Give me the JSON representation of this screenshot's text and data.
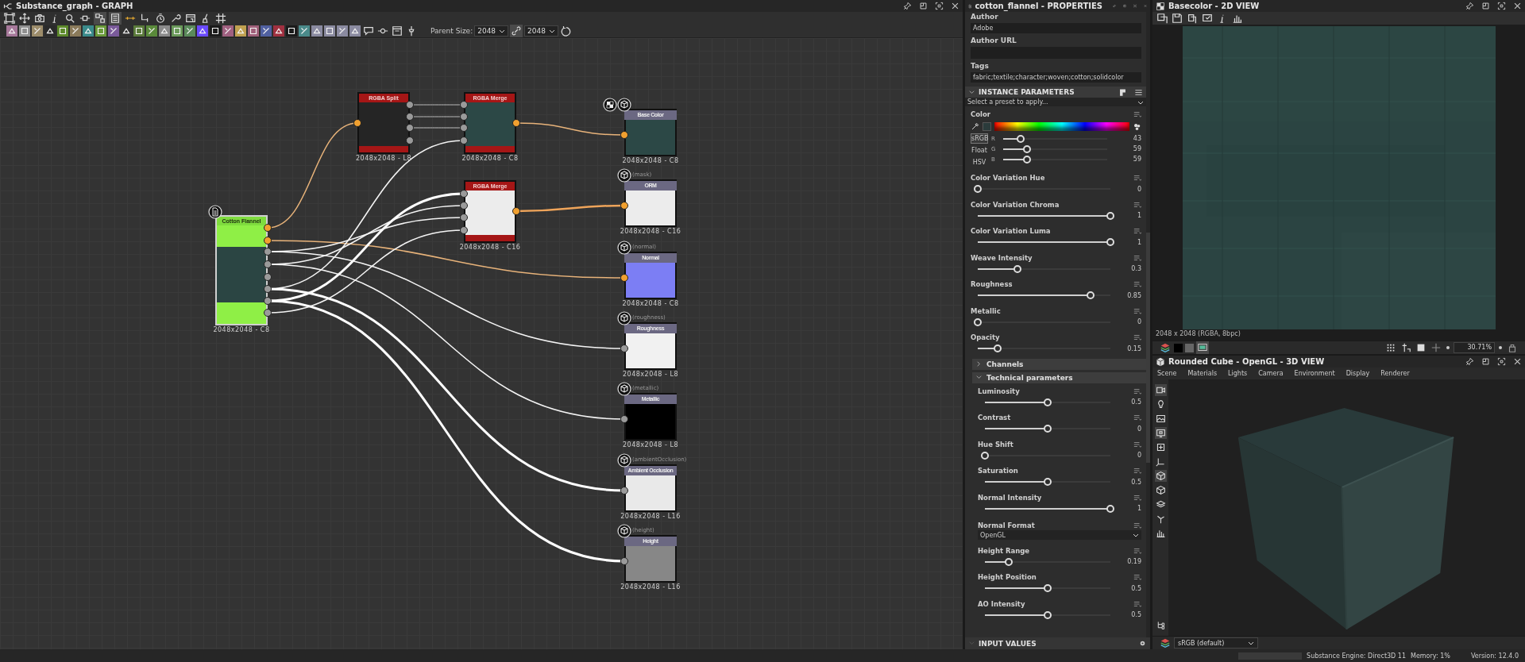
{
  "graph": {
    "title": "Substance_graph - GRAPH",
    "parent_size_label": "Parent Size:",
    "parent_size": "2048",
    "output_size": "2048",
    "nodes": [
      {
        "kind": "input",
        "title": "Cotton Flannel",
        "caption": "2048x2048 - C8"
      },
      {
        "kind": "filter",
        "title": "RGBA Split",
        "caption": "2048x2048 - L8"
      },
      {
        "kind": "filter",
        "title": "RGBA Merge",
        "caption": "2048x2048 - C8"
      },
      {
        "kind": "filter",
        "title": "RGBA Merge",
        "caption": "2048x2048 - C16"
      },
      {
        "kind": "output",
        "title": "Base Color",
        "caption": "2048x2048 - C8"
      },
      {
        "kind": "output",
        "title": "ORM",
        "usage": "(mask)",
        "caption": "2048x2048 - C16"
      },
      {
        "kind": "output",
        "title": "Normal",
        "usage": "(normal)",
        "caption": "2048x2048 - C8"
      },
      {
        "kind": "output",
        "title": "Roughness",
        "usage": "(roughness)",
        "caption": "2048x2048 - L8"
      },
      {
        "kind": "output",
        "title": "Metallic",
        "usage": "(metallic)",
        "caption": "2048x2048 - L8"
      },
      {
        "kind": "output",
        "title": "Ambient Occlusion",
        "usage": "(ambientOcclusion)",
        "caption": "2048x2048 - L16"
      },
      {
        "kind": "output",
        "title": "Height",
        "usage": "(height)",
        "caption": "2048x2048 - L16"
      }
    ]
  },
  "properties": {
    "title": "cotton_flannel - PROPERTIES",
    "fields": [
      {
        "label": "Author",
        "value": "Adobe"
      },
      {
        "label": "Author URL"
      },
      {
        "label": "Tags",
        "value": "fabric;textile;character;woven;cotton;solidcolor"
      }
    ],
    "instance_header": "INSTANCE PARAMETERS",
    "preset_placeholder": "Select a preset to apply...",
    "color": {
      "label": "Color",
      "modes": [
        {
          "label": "sRGB",
          "selected": true
        },
        {
          "label": "Float",
          "selected": false
        },
        {
          "label": "HSV",
          "selected": false
        }
      ],
      "channels": [
        {
          "name": "R",
          "level": 0.17,
          "reading": "43"
        },
        {
          "name": "G",
          "level": 0.23,
          "reading": "59"
        },
        {
          "name": "B",
          "level": 0.23,
          "reading": "59"
        }
      ]
    },
    "parameters": [
      {
        "kind": "slider",
        "label": "Color Variation Hue",
        "level": 0,
        "reading": "0"
      },
      {
        "kind": "slider",
        "label": "Color Variation Chroma",
        "level": 1,
        "reading": "1"
      },
      {
        "kind": "slider",
        "label": "Color Variation Luma",
        "level": 1,
        "reading": "1"
      },
      {
        "kind": "slider",
        "label": "Weave Intensity",
        "level": 0.3,
        "reading": "0.3"
      },
      {
        "kind": "slider",
        "label": "Roughness",
        "level": 0.85,
        "reading": "0.85"
      },
      {
        "kind": "slider",
        "label": "Metallic",
        "level": 0,
        "reading": "0"
      },
      {
        "kind": "slider",
        "label": "Opacity",
        "level": 0.15,
        "reading": "0.15"
      }
    ],
    "groups": [
      {
        "label": "Channels",
        "expanded": false
      },
      {
        "label": "Technical parameters",
        "expanded": true,
        "parameters": [
          {
            "kind": "slider",
            "label": "Luminosity",
            "level": 0.5,
            "reading": "0.5"
          },
          {
            "kind": "slider",
            "label": "Contrast",
            "level": 0.5,
            "reading": "0"
          },
          {
            "kind": "slider",
            "label": "Hue Shift",
            "level": 0,
            "reading": "0"
          },
          {
            "kind": "slider",
            "label": "Saturation",
            "level": 0.5,
            "reading": "0.5"
          },
          {
            "kind": "slider",
            "label": "Normal Intensity",
            "level": 1,
            "reading": "1"
          },
          {
            "kind": "dropdown",
            "label": "Normal Format",
            "value": "OpenGL"
          },
          {
            "kind": "slider",
            "label": "Height Range",
            "level": 0.19,
            "reading": "0.19"
          },
          {
            "kind": "slider",
            "label": "Height Position",
            "level": 0.5,
            "reading": "0.5"
          },
          {
            "kind": "slider",
            "label": "AO Intensity",
            "level": 0.5,
            "reading": "0.5"
          }
        ]
      }
    ],
    "input_values_header": "INPUT VALUES"
  },
  "view2d": {
    "title": "Basecolor - 2D VIEW",
    "info": "2048 x 2048 (RGBA, 8bpc)",
    "zoom": "30.71%"
  },
  "view3d": {
    "title": "Rounded Cube - OpenGL - 3D VIEW",
    "menu": [
      "Scene",
      "Materials",
      "Lights",
      "Camera",
      "Environment",
      "Display",
      "Renderer"
    ],
    "colorspace": "sRGB (default)"
  },
  "status_bar": {
    "progress": {
      "level": 0
    },
    "engine": "Substance Engine: Direct3D 11",
    "memory": "Memory: 1%",
    "version": "Version: 12.4.0"
  }
}
